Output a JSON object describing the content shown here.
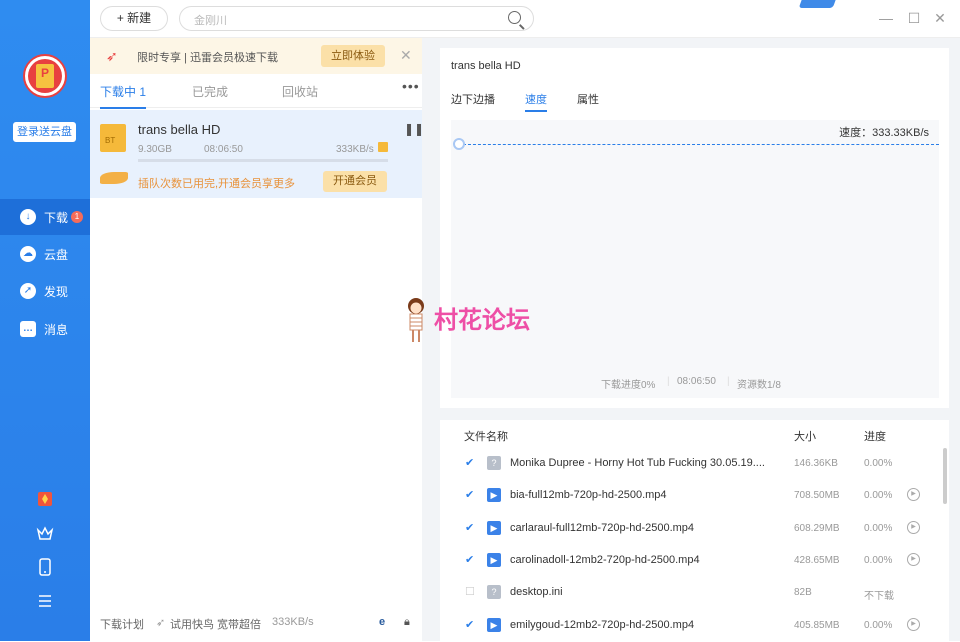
{
  "sidebar": {
    "cloud_login": "登录送云盘",
    "nav": [
      {
        "label": "下载",
        "badge": "1"
      },
      {
        "label": "云盘"
      },
      {
        "label": "发现"
      },
      {
        "label": "消息"
      }
    ]
  },
  "toolbar": {
    "new_label": "+ 新建",
    "search_placeholder": "金刚川"
  },
  "promo": {
    "text": "限时专享 | 迅雷会员极速下载",
    "button": "立即体验"
  },
  "tabs": {
    "downloading": "下载中 1",
    "completed": "已完成",
    "recycle": "回收站"
  },
  "task": {
    "name": "trans bella HD",
    "size": "9.30GB",
    "time": "08:06:50",
    "speed": "333KB/s",
    "progress": 0,
    "vip_text": "插队次数已用完,开通会员享更多",
    "vip_button": "开通会员"
  },
  "status_bar": {
    "plan": "下载计划",
    "trial": "试用快鸟 宽带超倍",
    "speed": "333KB/s"
  },
  "detail": {
    "title": "trans bella HD",
    "tabs": [
      "边下边播",
      "速度",
      "属性"
    ],
    "speed_label": "速度：333.33KB/s",
    "progress": "下载进度0%",
    "time": "08:06:50",
    "sources": "资源数1/8"
  },
  "files": {
    "headers": {
      "name": "文件名称",
      "size": "大小",
      "progress": "进度"
    },
    "rows": [
      {
        "checked": true,
        "type": "unknown",
        "name": "Monika Dupree - Horny Hot Tub Fucking 30.05.19....",
        "size": "146.36KB",
        "progress": "0.00%",
        "play": false
      },
      {
        "checked": true,
        "type": "video",
        "name": "bia-full12mb-720p-hd-2500.mp4",
        "size": "708.50MB",
        "progress": "0.00%",
        "play": true
      },
      {
        "checked": true,
        "type": "video",
        "name": "carlaraul-full12mb-720p-hd-2500.mp4",
        "size": "608.29MB",
        "progress": "0.00%",
        "play": true
      },
      {
        "checked": true,
        "type": "video",
        "name": "carolinadoll-12mb2-720p-hd-2500.mp4",
        "size": "428.65MB",
        "progress": "0.00%",
        "play": true
      },
      {
        "checked": false,
        "type": "unknown",
        "name": "desktop.ini",
        "size": "82B",
        "progress": "不下载",
        "play": false
      },
      {
        "checked": true,
        "type": "video",
        "name": "emilygoud-12mb2-720p-hd-2500.mp4",
        "size": "405.85MB",
        "progress": "0.00%",
        "play": true
      }
    ]
  },
  "watermark": "村花论坛",
  "colors": {
    "accent": "#2a7ee8",
    "sidebar": "#2f8cf0",
    "vip": "#fbe0a8"
  }
}
